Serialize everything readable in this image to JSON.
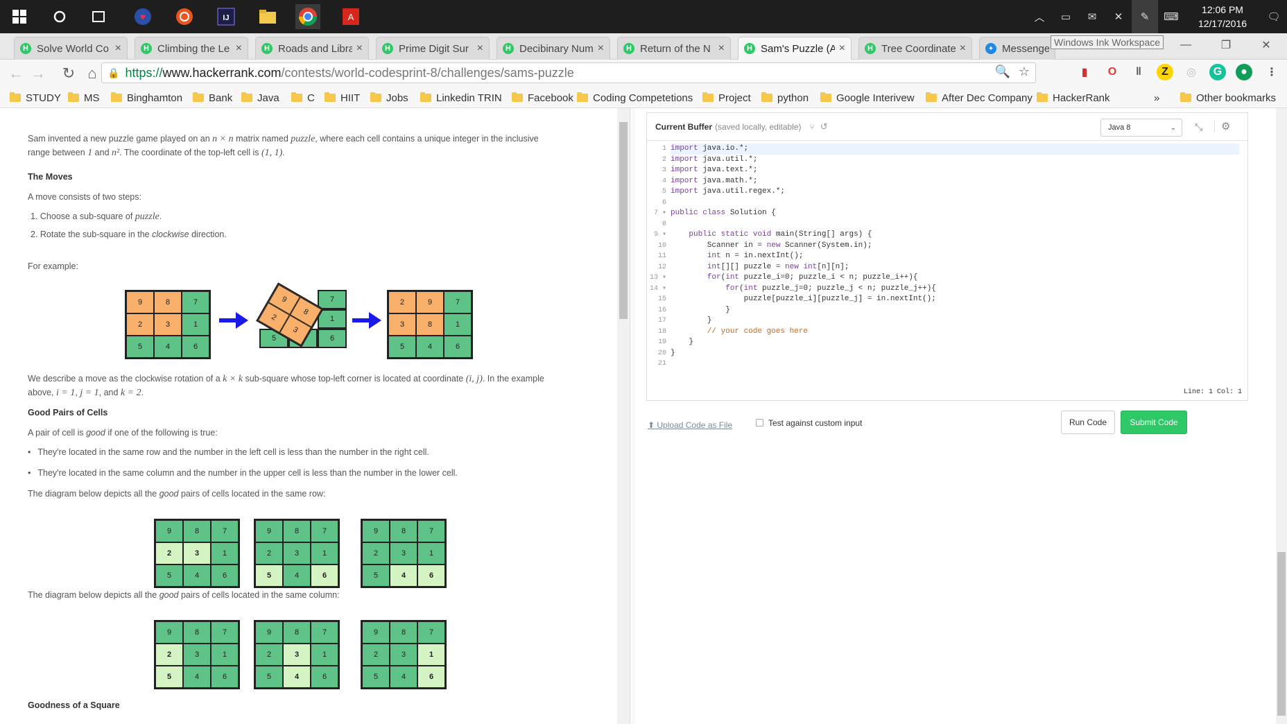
{
  "taskbar": {
    "time": "12:06 PM",
    "date": "12/17/2016"
  },
  "tabs": [
    {
      "label": "Solve World Co",
      "icon": "hackerrank-icon"
    },
    {
      "label": "Climbing the Le",
      "icon": "hackerrank-icon"
    },
    {
      "label": "Roads and Libra",
      "icon": "hackerrank-icon"
    },
    {
      "label": "Prime Digit Sur",
      "icon": "hackerrank-icon"
    },
    {
      "label": "Decibinary Num",
      "icon": "hackerrank-icon"
    },
    {
      "label": "Return of the N",
      "icon": "hackerrank-icon"
    },
    {
      "label": "Sam's Puzzle (A",
      "icon": "hackerrank-icon",
      "active": true
    },
    {
      "label": "Tree Coordinate",
      "icon": "hackerrank-icon"
    },
    {
      "label": "Messenger",
      "icon": "messenger-icon"
    }
  ],
  "tooltip": "Windows Ink Workspace",
  "address": {
    "scheme": "https://",
    "host": "www.hackerrank.com",
    "path": "/contests/world-codesprint-8/challenges/sams-puzzle"
  },
  "bookmarks": [
    "STUDY",
    "MS",
    "Binghamton",
    "Bank",
    "Java",
    "C",
    "HIIT",
    "Jobs",
    "Linkedin TRIN",
    "Facebook",
    "Coding Competetions",
    "Project",
    "python",
    "Google Interivew",
    "After Dec Company",
    "HackerRank"
  ],
  "bookmarks_more": "»",
  "bookmarks_other": "Other bookmarks",
  "problem": {
    "intro_a": "Sam invented a new puzzle game played on an ",
    "intro_m1": "n × n",
    "intro_b": " matrix named ",
    "intro_m2": "puzzle",
    "intro_c": ", where each cell contains a unique integer in the inclusive",
    "intro2_a": "range between ",
    "intro2_m1": "1",
    "intro2_b": " and ",
    "intro2_m2": "n²",
    "intro2_c": ". The coordinate of the top-left cell is ",
    "intro2_m3": "(1, 1)",
    "intro2_d": ".",
    "moves_heading": "The Moves",
    "move_def": "A move consists of two steps:",
    "step1_a": "1. Choose a sub-square of ",
    "step1_m": "puzzle",
    "step1_b": ".",
    "step2_a": "2. Rotate the sub-square in the ",
    "step2_i": "clockwise",
    "step2_b": " direction.",
    "for_example": "For example:",
    "describe_a": "We describe a move as the clockwise rotation of a ",
    "describe_m1": "k × k",
    "describe_b": " sub-square whose top-left corner is located at coordinate ",
    "describe_m2": "(i, j)",
    "describe_c": ". In the example",
    "describe2_a": "above, ",
    "describe2_m1": "i = 1",
    "describe2_b": ", ",
    "describe2_m2": "j = 1",
    "describe2_c": ", and ",
    "describe2_m3": "k = 2",
    "describe2_d": ".",
    "good_heading": "Good Pairs of Cells",
    "good_def_a": "A pair of cell is ",
    "good_def_i": "good",
    "good_def_b": " if one of the following is true:",
    "bullet1": "They're located in the same row and the number in the left cell is less than the number in the right cell.",
    "bullet2": "They're located in the same column and the number in the upper cell is less than the number in the lower cell.",
    "row_caption_a": "The diagram below depicts all the ",
    "row_caption_i": "good",
    "row_caption_b": " pairs of cells located in the same row:",
    "col_caption_a": "The diagram below depicts all the ",
    "col_caption_i": "good",
    "col_caption_b": " pairs of cells located in the same column:",
    "goodness_heading": "Goodness of a Square"
  },
  "example_grid_before": [
    "9",
    "8",
    "7",
    "2",
    "3",
    "1",
    "5",
    "4",
    "6"
  ],
  "example_grid_mid_rotated": [
    "9",
    "8",
    "2",
    "3"
  ],
  "example_grid_mid_fixed": [
    "7",
    "1",
    "5",
    "4",
    "6"
  ],
  "example_grid_after": [
    "2",
    "9",
    "7",
    "3",
    "8",
    "1",
    "5",
    "4",
    "6"
  ],
  "row_grids": [
    {
      "values": [
        "9",
        "8",
        "7",
        "2",
        "3",
        "1",
        "5",
        "4",
        "6"
      ],
      "light": [
        3,
        4
      ],
      "bold": [
        3,
        4
      ]
    },
    {
      "values": [
        "9",
        "8",
        "7",
        "2",
        "3",
        "1",
        "5",
        "4",
        "6"
      ],
      "light": [
        6,
        8
      ],
      "bold": [
        6,
        8
      ]
    },
    {
      "values": [
        "9",
        "8",
        "7",
        "2",
        "3",
        "1",
        "5",
        "4",
        "6"
      ],
      "light": [
        7,
        8
      ],
      "bold": [
        7,
        8
      ]
    }
  ],
  "col_grids": [
    {
      "values": [
        "9",
        "8",
        "7",
        "2",
        "3",
        "1",
        "5",
        "4",
        "6"
      ],
      "light": [
        3,
        6
      ],
      "bold": [
        3,
        6
      ]
    },
    {
      "values": [
        "9",
        "8",
        "7",
        "2",
        "3",
        "1",
        "5",
        "4",
        "6"
      ],
      "light": [
        4,
        7
      ],
      "bold": [
        4,
        7
      ]
    },
    {
      "values": [
        "9",
        "8",
        "7",
        "2",
        "3",
        "1",
        "5",
        "4",
        "6"
      ],
      "light": [
        5,
        8
      ],
      "bold": [
        5,
        8
      ]
    }
  ],
  "editor": {
    "title": "Current Buffer",
    "subtitle": "(saved locally, editable)",
    "language": "Java 8",
    "status": "Line: 1 Col: 1",
    "lines": [
      "import java.io.*;",
      "import java.util.*;",
      "import java.text.*;",
      "import java.math.*;",
      "import java.util.regex.*;",
      "",
      "public class Solution {",
      "",
      "    public static void main(String[] args) {",
      "        Scanner in = new Scanner(System.in);",
      "        int n = in.nextInt();",
      "        int[][] puzzle = new int[n][n];",
      "        for(int puzzle_i=0; puzzle_i < n; puzzle_i++){",
      "            for(int puzzle_j=0; puzzle_j < n; puzzle_j++){",
      "                puzzle[puzzle_i][puzzle_j] = in.nextInt();",
      "            }",
      "        }",
      "        // your code goes here",
      "    }",
      "}",
      ""
    ]
  },
  "actions": {
    "upload": "Upload Code as File",
    "custom_input": "Test against custom input",
    "run": "Run Code",
    "submit": "Submit Code"
  }
}
